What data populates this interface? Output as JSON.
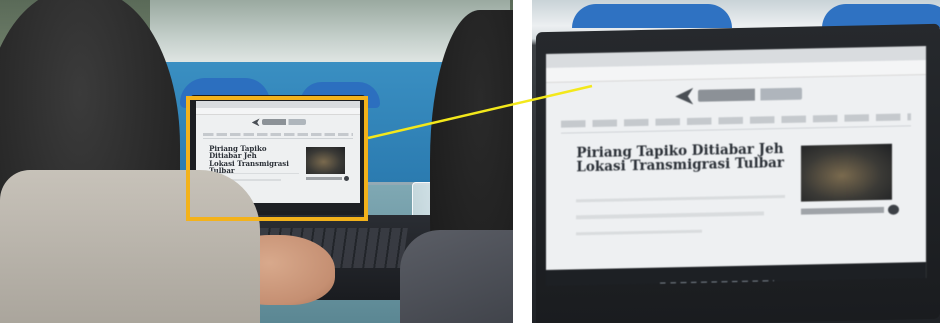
{
  "article": {
    "headline_line1": "Piriang Tapiko Ditiabar Jeh",
    "headline_line2": "Lokasi Transmigrasi Tulbar"
  },
  "colors": {
    "highlight_box": "#f3b21b",
    "connector_line": "#f3e81b"
  }
}
